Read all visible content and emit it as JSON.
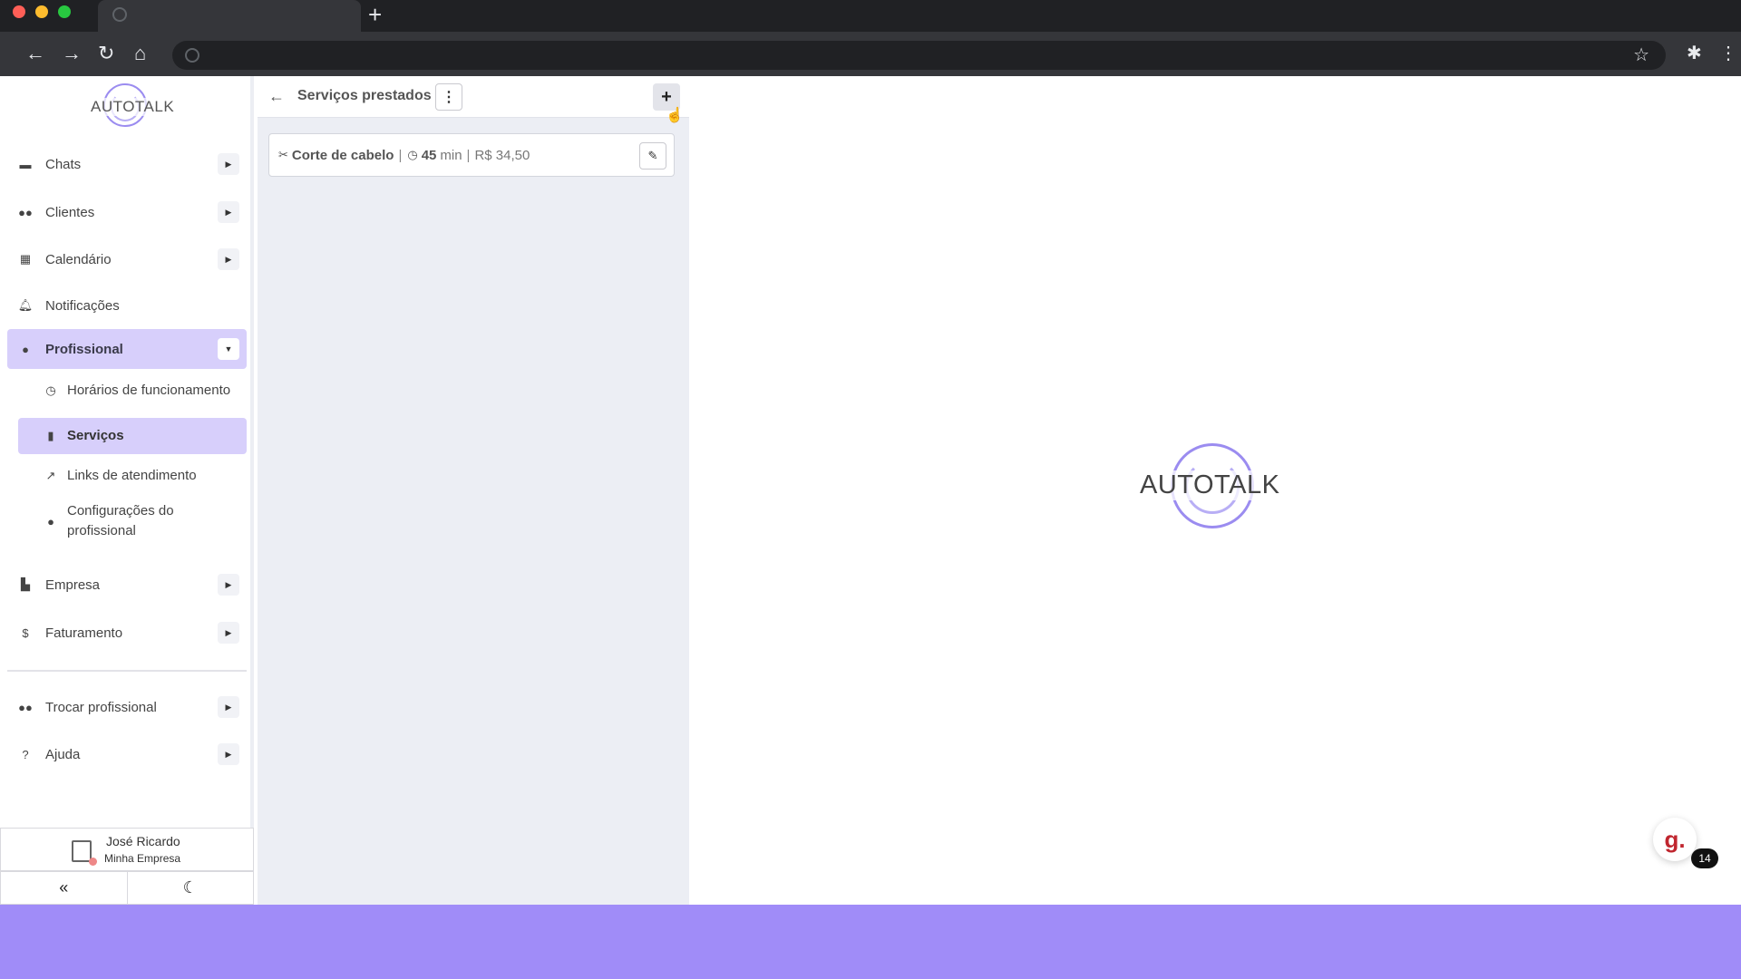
{
  "browser": {
    "new_tab_glyph": "+"
  },
  "app": {
    "logo_text": "AUTOTALK"
  },
  "sidebar": {
    "items": [
      {
        "label": "Chats",
        "icon": "chat-icon"
      },
      {
        "label": "Clientes",
        "icon": "users-icon"
      },
      {
        "label": "Calendário",
        "icon": "calendar-icon"
      },
      {
        "label": "Notificações",
        "icon": "bell-icon"
      },
      {
        "label": "Profissional",
        "icon": "user-gear-icon"
      },
      {
        "label": "Empresa",
        "icon": "building-icon"
      },
      {
        "label": "Faturamento",
        "icon": "dollar-icon"
      },
      {
        "label": "Trocar profissional",
        "icon": "users-swap-icon"
      },
      {
        "label": "Ajuda",
        "icon": "help-icon"
      }
    ],
    "subitems": [
      {
        "label": "Horários de funcionamento",
        "icon": "clock-icon"
      },
      {
        "label": "Serviços",
        "icon": "clipboard-icon"
      },
      {
        "label": "Links de atendimento",
        "icon": "external-link-icon"
      },
      {
        "label": "Configurações do profissional",
        "icon": "user-settings-icon"
      }
    ],
    "user": {
      "name": "José Ricardo",
      "company": "Minha Empresa"
    }
  },
  "services_panel": {
    "title": "Serviços prestados",
    "items": [
      {
        "name": "Corte de cabelo",
        "duration": "45",
        "unit": "min",
        "price": "R$ 34,50"
      }
    ]
  },
  "chat_widget": {
    "glyph": "g.",
    "badge_count": "14"
  },
  "colors": {
    "accent": "#d7cffb",
    "brand": "#9b8cf0",
    "page_background": "#a08cf8"
  }
}
